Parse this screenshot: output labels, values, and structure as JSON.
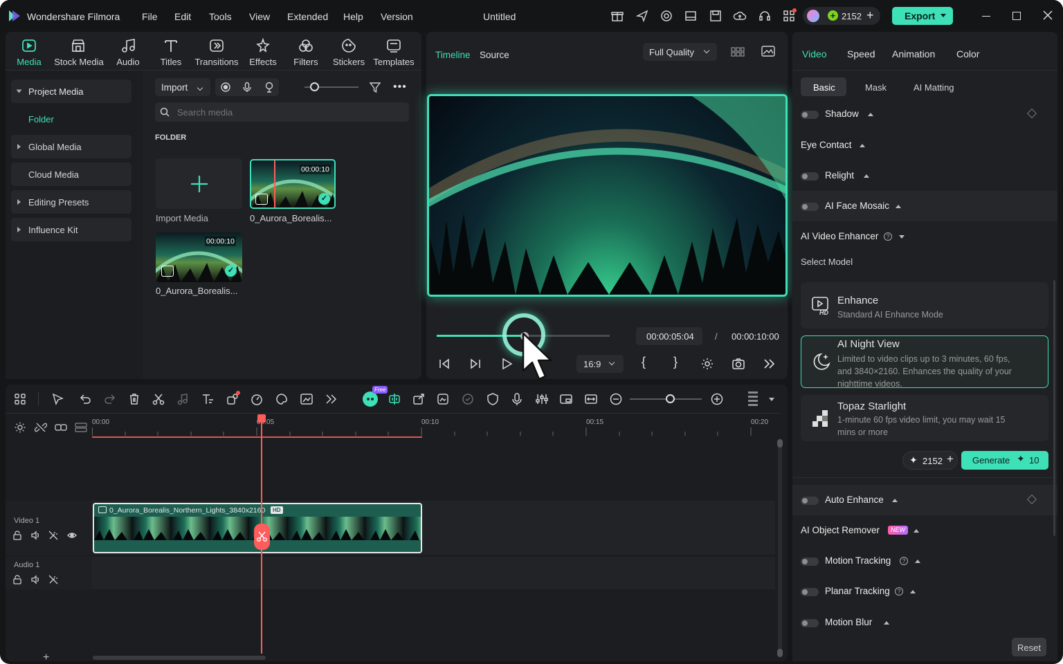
{
  "app": {
    "name": "Wondershare Filmora",
    "window_title": "Untitled"
  },
  "menu": [
    "File",
    "Edit",
    "Tools",
    "View",
    "Extended",
    "Help",
    "Version"
  ],
  "titlebar": {
    "credits": "2152",
    "export_label": "Export"
  },
  "media_tabs": [
    "Media",
    "Stock Media",
    "Audio",
    "Titles",
    "Transitions",
    "Effects",
    "Filters",
    "Stickers",
    "Templates"
  ],
  "sidebar": {
    "items": [
      {
        "label": "Project Media"
      },
      {
        "label": "Folder"
      },
      {
        "label": "Global Media"
      },
      {
        "label": "Cloud Media"
      },
      {
        "label": "Editing Presets"
      },
      {
        "label": "Influence Kit"
      }
    ]
  },
  "media": {
    "import_label": "Import",
    "search_placeholder": "Search media",
    "folder_heading": "FOLDER",
    "import_tile_label": "Import Media",
    "clips": [
      {
        "name": "0_Aurora_Borealis...",
        "duration": "00:00:10"
      },
      {
        "name": "0_Aurora_Borealis...",
        "duration": "00:00:10"
      }
    ]
  },
  "player": {
    "tabs": [
      "Timeline",
      "Source"
    ],
    "quality": "Full Quality",
    "current_time": "00:00:05:04",
    "separator": "/",
    "total_time": "00:00:10:00",
    "aspect": "16:9",
    "progress_fraction": 0.51
  },
  "right_panel": {
    "tabs": [
      "Video",
      "Speed",
      "Animation",
      "Color"
    ],
    "subtabs": [
      "Basic",
      "Mask",
      "AI Matting"
    ],
    "rows_top": [
      "Shadow",
      "Eye Contact",
      "Relight",
      "AI Face Mosaic"
    ],
    "enhancer_title": "AI Video Enhancer",
    "select_model": "Select Model",
    "models": [
      {
        "title": "Enhance",
        "desc": "Standard AI Enhance Mode"
      },
      {
        "title": "AI Night View",
        "desc": "Limited to video clips up to 3 minutes, 60 fps, and 3840×2160. Enhances the quality of your nighttime videos."
      },
      {
        "title": "Topaz Starlight",
        "desc": "1-minute 60 fps video limit, you may wait 15 mins or more"
      }
    ],
    "credits": "2152",
    "generate_label": "Generate",
    "generate_cost": "10",
    "rows_bottom": [
      "Auto Enhance",
      "AI Object Remover",
      "Motion Tracking",
      "Planar Tracking",
      "Motion Blur"
    ],
    "new_badge": "NEW",
    "reset_label": "Reset"
  },
  "timeline": {
    "free_badge": "Free",
    "ruler": [
      "00:00",
      "00:05",
      "00:10",
      "00:15",
      "00:20"
    ],
    "tracks": [
      {
        "name": "Video 1"
      },
      {
        "name": "Audio 1"
      }
    ],
    "clip_name": "0_Aurora_Borealis_Northern_Lights_3840x2160",
    "clip_badge": "HD"
  },
  "colors": {
    "accent": "#3ee0b8",
    "playhead": "#ff5c5c",
    "panel": "#1f2023"
  }
}
